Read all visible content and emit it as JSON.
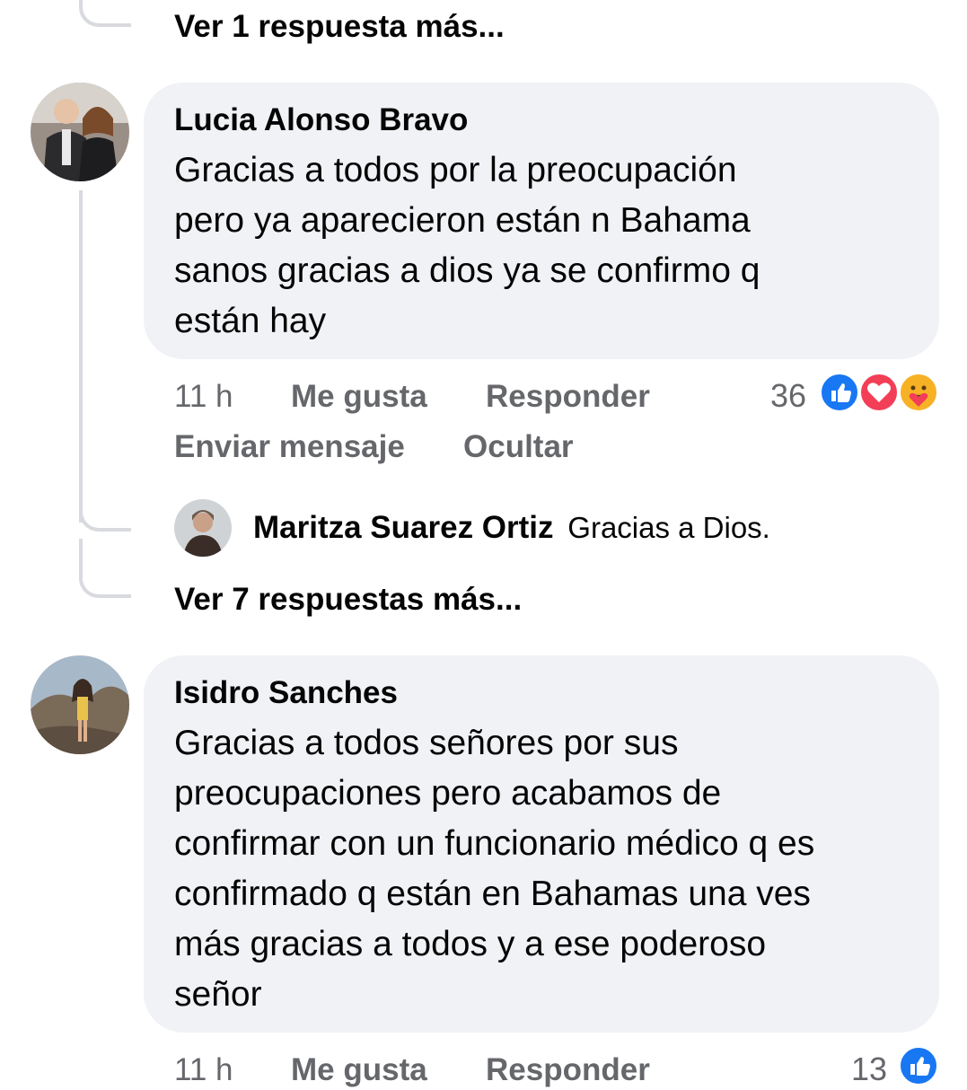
{
  "thread": {
    "view_more_top": "Ver 1 respuesta más...",
    "view_more_mid": "Ver 7 respuestas más..."
  },
  "comments": [
    {
      "author": "Lucia Alonso Bravo",
      "lines": [
        "Gracias  a todos por la preocupación",
        "pero ya aparecieron están n Bahama",
        "sanos gracias a dios ya se confirmo q",
        "están hay"
      ],
      "time": "11 h",
      "like_label": "Me gusta",
      "reply_label": "Responder",
      "send_label": "Enviar mensaje",
      "hide_label": "Ocultar",
      "reaction_count": "36",
      "reactions": [
        "like-icon",
        "love-icon",
        "care-icon"
      ]
    },
    {
      "author": "Isidro Sanches",
      "lines": [
        "Gracias a todos señores por sus",
        "preocupaciones pero acabamos de",
        "confirmar con un funcionario médico q es",
        "confirmado q están en Bahamas una ves",
        "más gracias a todos y a ese poderoso",
        "señor"
      ],
      "time": "11 h",
      "like_label": "Me gusta",
      "reply_label": "Responder",
      "reaction_count": "13",
      "reactions": [
        "like-icon"
      ]
    }
  ],
  "reply": {
    "author": "Maritza Suarez Ortiz",
    "text": "Gracias a Dios."
  },
  "colors": {
    "bubble": "#f0f2f5",
    "secondary_text": "#65676b",
    "like_blue": "#1877f2",
    "love_red": "#f33e58",
    "care_yellow": "#f7b125"
  }
}
